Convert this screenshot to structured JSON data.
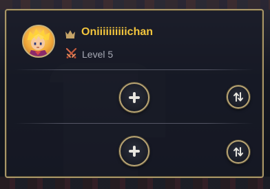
{
  "player": {
    "name": "Oniiiiiiiiiichan",
    "level": "Level 5",
    "rank_icon": "crown-icon",
    "class_icon": "crossed-swords-icon"
  },
  "slots": [
    {
      "add_icon": "plus-icon",
      "swap_icon": "swap-arrows-icon"
    },
    {
      "add_icon": "plus-icon",
      "swap_icon": "swap-arrows-icon"
    }
  ],
  "colors": {
    "name": "#f2c53d",
    "level": "#a7aab5",
    "border_gold": "#a89668",
    "panel_bg": "#181b27"
  }
}
